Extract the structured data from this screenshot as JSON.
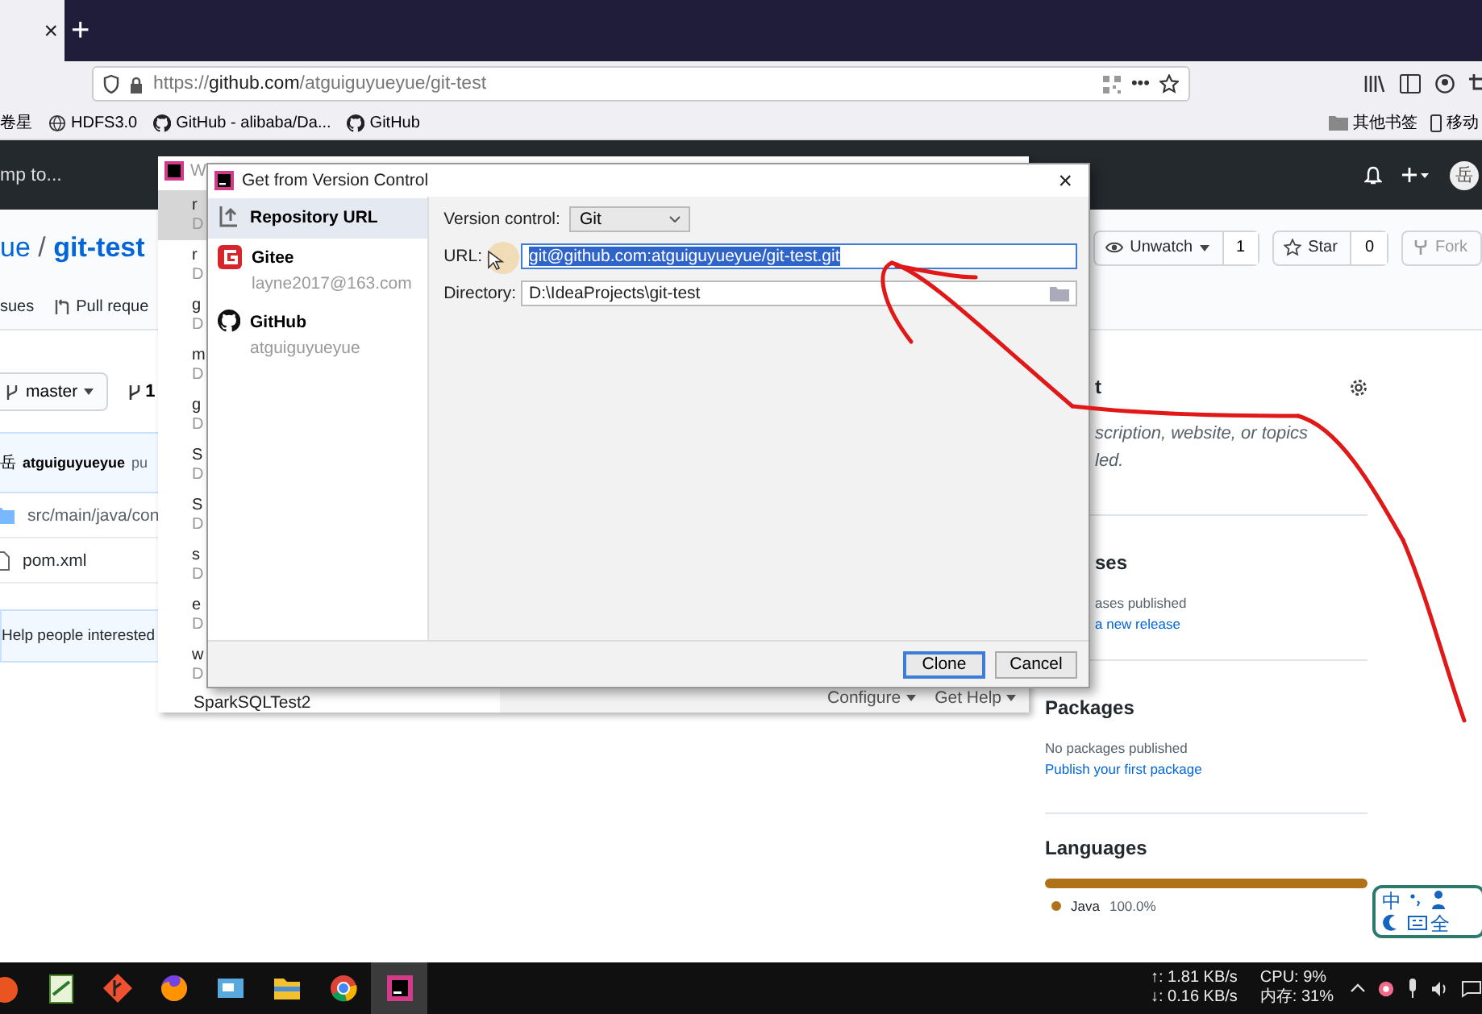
{
  "browser": {
    "tab_close": "×",
    "new_tab": "+",
    "url": "https://**github.com**/atguiguyueyue/git-test",
    "page_actions": "•••",
    "bookmarks": [
      {
        "kind": "plain",
        "label": "卷星"
      },
      {
        "kind": "globe",
        "label": "HDFS3.0"
      },
      {
        "kind": "github",
        "label": "GitHub - alibaba/Da..."
      },
      {
        "kind": "github",
        "label": "GitHub"
      }
    ],
    "other_bookmarks": [
      {
        "kind": "folder",
        "label": "其他书签"
      },
      {
        "kind": "phone",
        "label": "移动"
      }
    ]
  },
  "github": {
    "search_placeholder": "mp to...",
    "header_avatar": "岳",
    "repo_owner": "ue",
    "repo_separator": "/",
    "repo_name": "git-test",
    "actions": [
      {
        "kind": "watch",
        "label": "Unwatch",
        "count": "1",
        "disabled": false
      },
      {
        "kind": "star",
        "label": "Star",
        "count": "0",
        "disabled": false
      },
      {
        "kind": "fork",
        "label": "Fork",
        "disabled": true
      }
    ],
    "tabs": [
      {
        "kind": "issues",
        "label": "sues"
      },
      {
        "kind": "pulls",
        "label": "Pull reque"
      }
    ],
    "branch": "master",
    "branch_count": "1",
    "commit": {
      "avatar": "岳",
      "author": "atguiguyueyue",
      "message": "pu"
    },
    "files": [
      {
        "kind": "folder",
        "name": "src/main/java/con"
      },
      {
        "kind": "file",
        "name": "pom.xml"
      }
    ],
    "banner": "Help people interested",
    "sidebar": {
      "about_heading": "t",
      "about_text": "scription, website, or topics",
      "about_text_2": "led.",
      "releases_heading": "ses",
      "releases_text": "ases published",
      "releases_link": "a new release",
      "packages_heading": "Packages",
      "packages_text": "No packages published",
      "packages_link": "Publish your first package",
      "languages_heading": "Languages",
      "languages": [
        {
          "name": "Java",
          "percent": "100.0%",
          "color": "#b07219",
          "level": 1
        }
      ]
    }
  },
  "welcome_window": {
    "title": "W",
    "projects": [
      {
        "name": "r",
        "path": "D",
        "selected": true
      },
      {
        "name": "r",
        "path": "D",
        "selected": false
      },
      {
        "name": "g",
        "path": "D",
        "selected": false
      },
      {
        "name": "m",
        "path": "D",
        "selected": false
      },
      {
        "name": "g",
        "path": "D",
        "selected": false
      },
      {
        "name": "S",
        "path": "D",
        "selected": false
      },
      {
        "name": "S",
        "path": "D",
        "selected": false
      },
      {
        "name": "s",
        "path": "D",
        "selected": false
      },
      {
        "name": "e",
        "path": "D",
        "selected": false
      },
      {
        "name": "w",
        "path": "D",
        "selected": false
      }
    ],
    "last_project": "SparkSQLTest2",
    "links": [
      "Configure",
      "Get Help"
    ]
  },
  "dialog": {
    "title": "Get from Version Control",
    "close": "×",
    "sources": [
      {
        "kind": "url",
        "label": "Repository URL",
        "selected": true
      },
      {
        "kind": "gitee",
        "label": "Gitee",
        "account": "layne2017@163.com",
        "selected": false
      },
      {
        "kind": "github",
        "label": "GitHub",
        "account": "atguiguyueyue",
        "selected": false
      }
    ],
    "version_control": {
      "label": "Version control:",
      "value": "Git"
    },
    "url": {
      "label": "URL:",
      "value": "git@github.com:atguiguyueyue/git-test.git",
      "selected": true
    },
    "directory": {
      "label": "Directory:",
      "value": "D:\\IdeaProjects\\git-test"
    },
    "buttons": [
      {
        "label": "Clone",
        "default": true
      },
      {
        "label": "Cancel",
        "default": false
      }
    ]
  },
  "ime": {
    "chars": [
      "中",
      "全"
    ]
  },
  "taskbar": {
    "apps": [
      {
        "kind": "orange",
        "active": false
      },
      {
        "kind": "notepad",
        "active": false
      },
      {
        "kind": "git",
        "active": false
      },
      {
        "kind": "firefox",
        "active": false
      },
      {
        "kind": "remote",
        "active": false
      },
      {
        "kind": "folder",
        "active": false
      },
      {
        "kind": "chrome",
        "active": false
      },
      {
        "kind": "idea",
        "active": true
      }
    ],
    "net_up": "↑: 1.81 KB/s",
    "net_down": "↓: 0.16 KB/s",
    "cpu": "CPU: 9%",
    "memory": "内存: 31%"
  }
}
